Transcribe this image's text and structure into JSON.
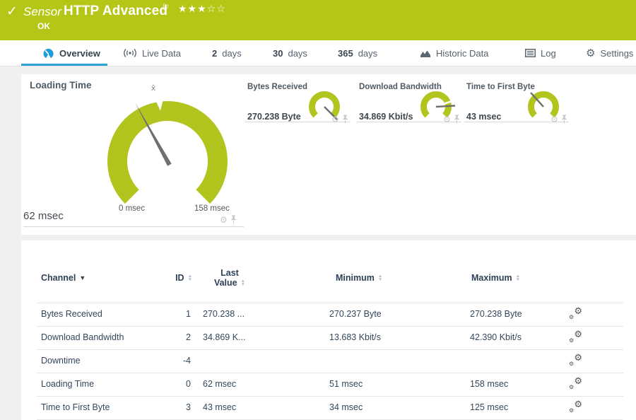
{
  "header": {
    "kind_label": "Sensor",
    "title": "HTTP Advanced",
    "status": "OK",
    "rating_filled": 3,
    "rating_total": 5
  },
  "tabs": [
    {
      "label": "Overview",
      "active": true
    },
    {
      "label": "Live Data"
    },
    {
      "number": "2",
      "label": "days"
    },
    {
      "number": "30",
      "label": "days"
    },
    {
      "number": "365",
      "label": "days"
    },
    {
      "label": "Historic Data"
    },
    {
      "label": "Log"
    },
    {
      "label": "Settings"
    }
  ],
  "gauges": {
    "loading_time": {
      "title": "Loading Time",
      "value_label": "62 msec",
      "value": 62,
      "min": 0,
      "max": 158,
      "min_label": "0 msec",
      "max_label": "158 msec",
      "unit": "msec"
    },
    "bytes_received": {
      "title": "Bytes Received",
      "value_label": "270.238 Byte"
    },
    "download_bandwidth": {
      "title": "Download Bandwidth",
      "value_label": "34.869 Kbit/s"
    },
    "time_to_first_byte": {
      "title": "Time to First Byte",
      "value_label": "43 msec"
    }
  },
  "table": {
    "header": {
      "channel": "Channel",
      "id": "ID",
      "last_1": "Last",
      "last_2": "Value",
      "min": "Minimum",
      "max": "Maximum"
    },
    "rows": [
      {
        "name": "Bytes Received",
        "id": "1",
        "last": "270.238 ...",
        "min": "270.237 Byte",
        "max": "270.238 Byte"
      },
      {
        "name": "Download Bandwidth",
        "id": "2",
        "last": "34.869 K...",
        "min": "13.683 Kbit/s",
        "max": "42.390 Kbit/s"
      },
      {
        "name": "Downtime",
        "id": "-4",
        "last": "",
        "min": "",
        "max": ""
      },
      {
        "name": "Loading Time",
        "id": "0",
        "last": "62 msec",
        "min": "51 msec",
        "max": "158 msec"
      },
      {
        "name": "Time to First Byte",
        "id": "3",
        "last": "43 msec",
        "min": "34 msec",
        "max": "125 msec"
      }
    ]
  },
  "icons": {
    "check": "✓",
    "flag": "⚐",
    "stars": "★★★☆☆",
    "gear": "⚙",
    "sort_up": "▲",
    "sort_down": "▼",
    "caret_down": "▼",
    "mean_marker": "x̄"
  },
  "colors": {
    "header_green": "#b5c617",
    "gauge_green": "#b2c41e",
    "accent_blue": "#2ba3d4",
    "needle_gray": "#6f6f6f",
    "text_navy": "#33475c"
  }
}
